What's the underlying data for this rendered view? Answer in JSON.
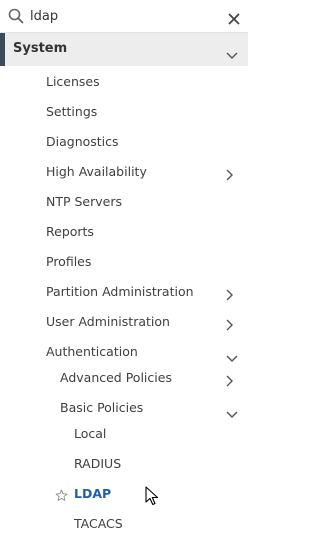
{
  "search": {
    "value": "ldap",
    "placeholder": ""
  },
  "section": {
    "title": "System"
  },
  "menu": {
    "licenses": "Licenses",
    "settings": "Settings",
    "diagnostics": "Diagnostics",
    "high_availability": "High Availability",
    "ntp_servers": "NTP Servers",
    "reports": "Reports",
    "profiles": "Profiles",
    "partition_administration": "Partition Administration",
    "user_administration": "User Administration",
    "authentication": "Authentication",
    "advanced_policies": "Advanced Policies",
    "basic_policies": "Basic Policies",
    "local": "Local",
    "radius": "RADIUS",
    "ldap": "LDAP",
    "tacacs": "TACACS"
  },
  "colors": {
    "accent": "#3d4a5a",
    "active_link": "#1f5fae",
    "header_bg": "#ededed"
  },
  "icons": [
    "search-icon",
    "close-icon",
    "chevron-down-icon",
    "chevron-right-icon",
    "star-icon",
    "mouse-pointer-icon"
  ]
}
